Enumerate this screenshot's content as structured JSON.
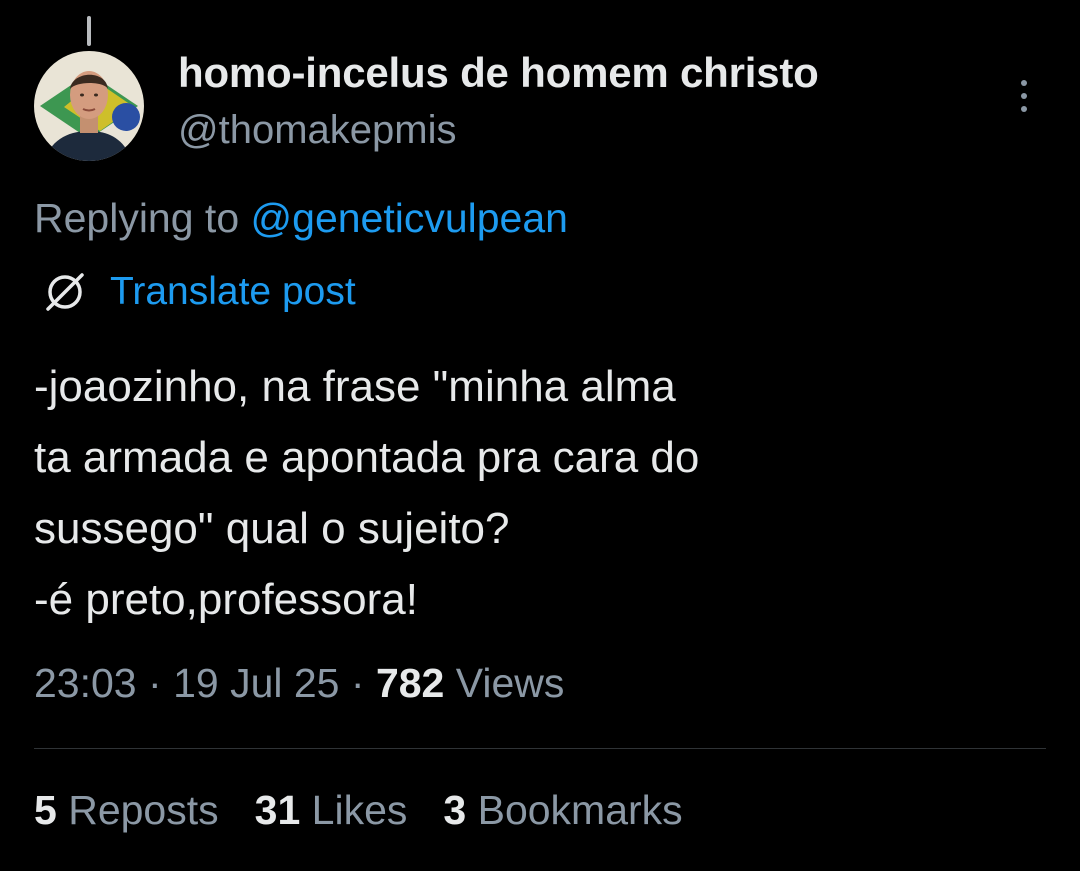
{
  "author": {
    "name": "homo-incelus de homem christo",
    "handle": "@thomakepmis",
    "avatar_icon": "profile-photo"
  },
  "reply": {
    "prefix": "Replying to ",
    "handle": "@geneticvulpean"
  },
  "translate": {
    "label": "Translate post",
    "icon": "globe-icon"
  },
  "post": {
    "lines": [
      "-joaozinho, na frase \"minha alma",
      "ta armada e apontada pra cara do",
      "sussego\" qual o sujeito?",
      "-é preto,professora!"
    ]
  },
  "meta": {
    "time": "23:03",
    "separator": "·",
    "date": "19 Jul 25",
    "views_count": "782",
    "views_label": "Views"
  },
  "stats": [
    {
      "count": "5",
      "label": "Reposts"
    },
    {
      "count": "31",
      "label": "Likes"
    },
    {
      "count": "3",
      "label": "Bookmarks"
    }
  ],
  "colors": {
    "background": "#000000",
    "text_primary": "#e7e9ea",
    "text_secondary": "#8b98a5",
    "link": "#1d9bf0",
    "divider": "#2f3336"
  }
}
